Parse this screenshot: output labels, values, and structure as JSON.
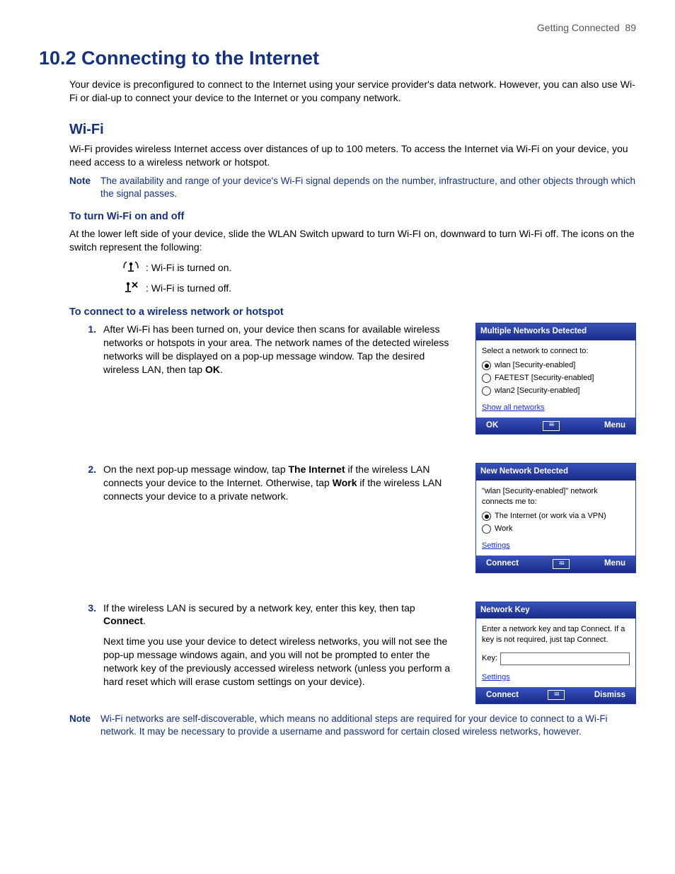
{
  "header": {
    "section": "Getting Connected",
    "page": "89"
  },
  "title": "10.2  Connecting to the Internet",
  "intro": "Your device is preconfigured to connect to the Internet using your service provider's data network. However, you can also use Wi-Fi or dial-up to connect your device to the Internet or you company network.",
  "wifi": {
    "heading": "Wi-Fi",
    "intro": "Wi-Fi provides wireless Internet access over distances of up to 100 meters. To access the Internet via Wi-Fi on your device, you need access to a wireless network or hotspot.",
    "note1_label": "Note",
    "note1": "The availability and range of your device's Wi-Fi signal depends on the number, infrastructure, and other objects through which the signal passes.",
    "onoff": {
      "heading": "To turn Wi-Fi on and off",
      "text": "At the lower left side of your device, slide the WLAN Switch upward to turn Wi-FI on, downward to turn Wi-Fi off. The icons on the switch represent the following:",
      "on": ":   Wi-Fi is turned on.",
      "off": ":   Wi-Fi is turned off."
    },
    "connect": {
      "heading": "To connect to a wireless network or hotspot",
      "step1_num": "1.",
      "step1_a": "After Wi-Fi has been turned on, your device then scans for available wireless networks or hotspots in your area. The network names of the detected wireless networks will be displayed on a pop-up message window. Tap the desired wireless LAN, then tap ",
      "step1_b": "OK",
      "step1_c": ".",
      "step2_num": "2.",
      "step2_a": "On the next pop-up message window, tap ",
      "step2_b": "The Internet",
      "step2_c": " if the wireless LAN connects your device to the Internet. Otherwise, tap ",
      "step2_d": "Work",
      "step2_e": " if the wireless LAN connects your device to a private network.",
      "step3_num": "3.",
      "step3_a": "If the wireless LAN is secured by a network key, enter this key, then tap ",
      "step3_b": "Connect",
      "step3_c": ".",
      "step3_p2": "Next time you use your device to detect wireless networks, you will not see the pop-up message windows again, and you will not be prompted to enter the network key of the previously accessed wireless network (unless you perform a hard reset which will erase custom settings on your device)."
    },
    "note2_label": "Note",
    "note2": "Wi-Fi networks are self-discoverable, which means no additional steps are required for your device to connect to a Wi-Fi network. It may be necessary to provide a username and password for certain closed wireless networks, however."
  },
  "mock1": {
    "title": "Multiple Networks Detected",
    "prompt": "Select a network to connect to:",
    "n1": "wlan [Security-enabled]",
    "n2": "FAETEST [Security-enabled]",
    "n3": "wlan2 [Security-enabled]",
    "link": "Show all networks",
    "left": "OK",
    "right": "Menu"
  },
  "mock2": {
    "title": "New Network Detected",
    "prompt": "\"wlan [Security-enabled]\" network connects me to:",
    "o1": "The Internet (or work via a VPN)",
    "o2": "Work",
    "link": "Settings",
    "left": "Connect",
    "right": "Menu"
  },
  "mock3": {
    "title": "Network Key",
    "prompt": "Enter a network key and tap Connect. If a key is not required, just tap Connect.",
    "keylabel": "Key:",
    "link": "Settings",
    "left": "Connect",
    "right": "Dismiss"
  }
}
